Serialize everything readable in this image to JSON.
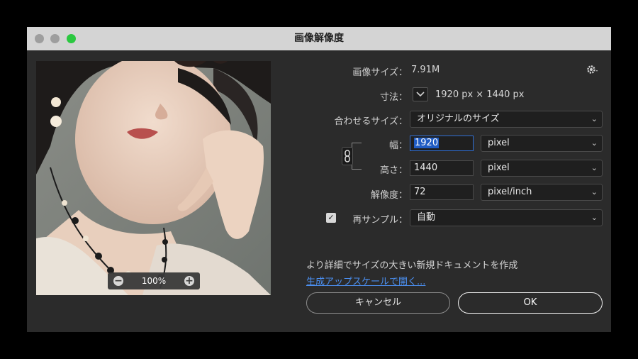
{
  "window": {
    "title": "画像解像度"
  },
  "preview": {
    "zoom": "100%",
    "zoom_out": "−",
    "zoom_in": "+"
  },
  "image_size": {
    "label": "画像サイズ：",
    "value": "7.91M"
  },
  "dimensions": {
    "label": "寸法：",
    "value": "1920 px × 1440 px"
  },
  "fit_to": {
    "label": "合わせるサイズ：",
    "value": "オリジナルのサイズ"
  },
  "width": {
    "label": "幅：",
    "value": "1920",
    "unit": "pixel"
  },
  "height": {
    "label": "高さ：",
    "value": "1440",
    "unit": "pixel"
  },
  "resolution": {
    "label": "解像度：",
    "value": "72",
    "unit": "pixel/inch"
  },
  "resample": {
    "label": "再サンプル：",
    "value": "自動",
    "checked": true
  },
  "info_text": "より詳細でサイズの大きい新規ドキュメントを作成",
  "upscale_link": "生成アップスケールで開く...",
  "buttons": {
    "cancel": "キャンセル",
    "ok": "OK"
  },
  "icons": {
    "settings": "gear-icon",
    "link": "chain-link-icon",
    "dimension_toggle": "chevron-down-icon"
  }
}
